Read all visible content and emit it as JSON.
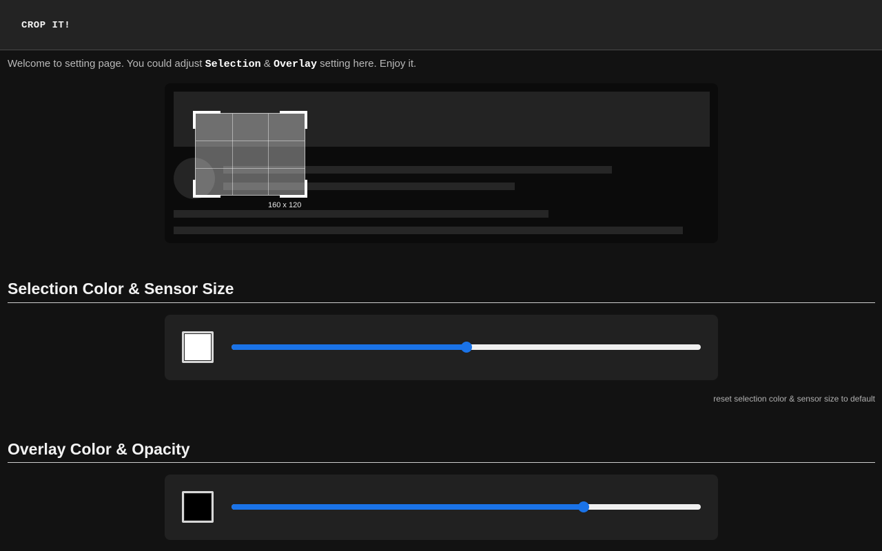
{
  "app": {
    "title": "CROP IT!"
  },
  "intro": {
    "prefix": "Welcome to setting page. You could adjust ",
    "keyword_selection": "Selection",
    "amp": " & ",
    "keyword_overlay": "Overlay",
    "suffix": " setting here. Enjoy it."
  },
  "preview": {
    "selection_size_label": "160 x 120"
  },
  "selection_section": {
    "title": "Selection Color & Sensor Size",
    "color": "#ffffff",
    "sensor_size_fraction": 0.5,
    "reset_label": "reset selection color & sensor size to default"
  },
  "overlay_section": {
    "title": "Overlay Color & Opacity",
    "color": "#000000",
    "opacity_fraction": 0.75
  },
  "accent_color": "#1a73e8"
}
